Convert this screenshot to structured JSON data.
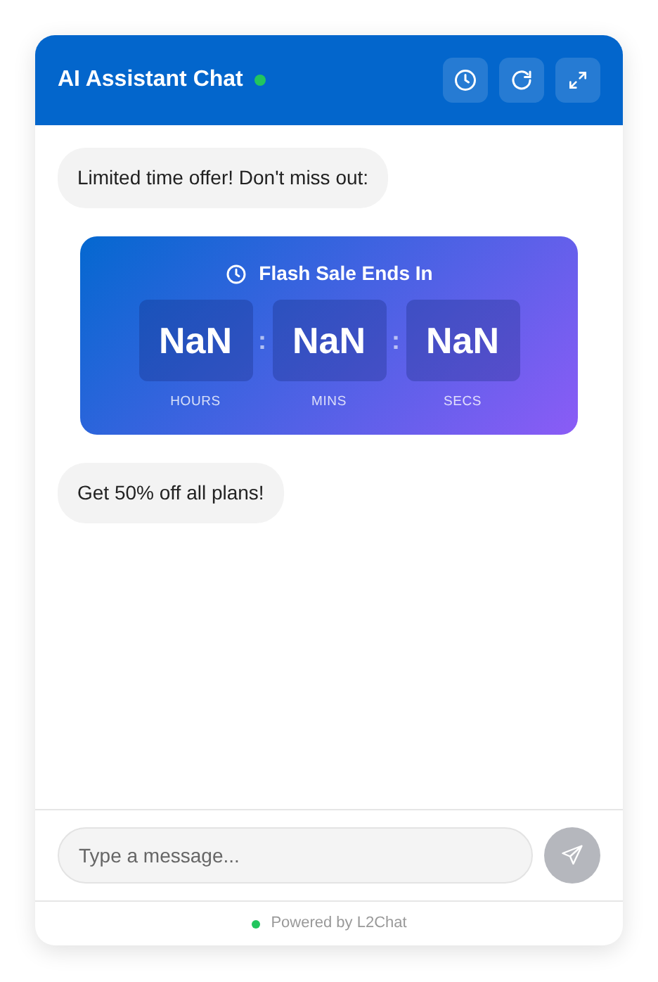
{
  "header": {
    "title": "AI Assistant Chat",
    "online": true
  },
  "messages": [
    {
      "kind": "text",
      "text": "Limited time offer! Don't miss out:"
    },
    {
      "kind": "countdown",
      "title": "Flash Sale Ends In",
      "units": [
        {
          "value": "NaN",
          "label": "HOURS"
        },
        {
          "value": "NaN",
          "label": "MINS"
        },
        {
          "value": "NaN",
          "label": "SECS"
        }
      ],
      "separator": ":"
    },
    {
      "kind": "text",
      "text": "Get 50% off all plans!"
    }
  ],
  "composer": {
    "placeholder": "Type a message...",
    "send_disabled": true
  },
  "footer": {
    "prefix": "Powered by",
    "brand": "L2Chat",
    "online": true
  }
}
